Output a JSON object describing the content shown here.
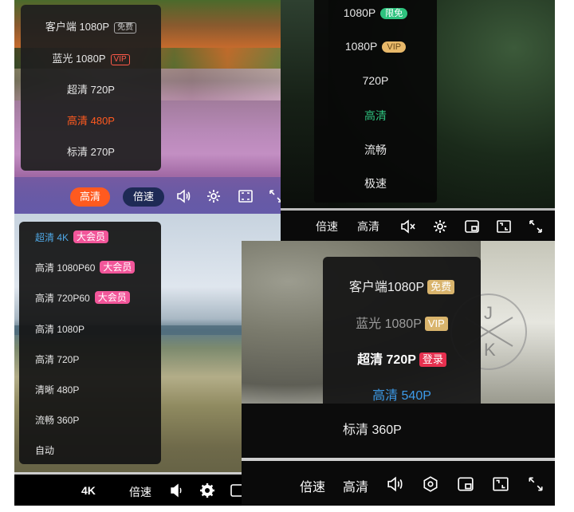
{
  "panel_a": {
    "menu": [
      {
        "label": "客户端 1080P",
        "tag": "免费"
      },
      {
        "label": "蓝光 1080P",
        "tag": "VIP"
      },
      {
        "label": "超清 720P",
        "tag": ""
      },
      {
        "label": "高清 480P",
        "tag": ""
      },
      {
        "label": "标清 270P",
        "tag": ""
      }
    ],
    "selected_index": 3,
    "quality_button": "高清",
    "speed_button": "倍速",
    "colors": {
      "accent": "#ff5a1f",
      "menu_bg": "#1e1e1e"
    }
  },
  "panel_b": {
    "menu": [
      {
        "label": "1080P",
        "tag": "限免"
      },
      {
        "label": "1080P",
        "tag": "VIP"
      },
      {
        "label": "720P",
        "tag": ""
      },
      {
        "label": "高清",
        "tag": ""
      },
      {
        "label": "流畅",
        "tag": ""
      },
      {
        "label": "极速",
        "tag": ""
      }
    ],
    "selected_index": 3,
    "speed_button": "倍速",
    "quality_button": "高清",
    "colors": {
      "accent": "#2ec27e",
      "vip": "#e8b96a"
    }
  },
  "panel_c": {
    "menu": [
      {
        "label": "超清 4K",
        "tag": "大会员"
      },
      {
        "label": "高清 1080P60",
        "tag": "大会员"
      },
      {
        "label": "高清 720P60",
        "tag": "大会员"
      },
      {
        "label": "高清 1080P",
        "tag": ""
      },
      {
        "label": "高清 720P",
        "tag": ""
      },
      {
        "label": "清晰 480P",
        "tag": ""
      },
      {
        "label": "流畅 360P",
        "tag": ""
      },
      {
        "label": "自动",
        "tag": ""
      }
    ],
    "selected_index": 0,
    "quality_button": "4K",
    "speed_button": "倍速",
    "colors": {
      "accent": "#4fa8e6",
      "tag": "#f2569a"
    }
  },
  "panel_d": {
    "menu": [
      {
        "label": "客户端1080P",
        "tag": "免费"
      },
      {
        "label": "蓝光 1080P",
        "tag": "VIP"
      },
      {
        "label": "超清 720P",
        "tag": "登录"
      },
      {
        "label": "高清 540P",
        "tag": ""
      },
      {
        "label": "标清 360P",
        "tag": ""
      }
    ],
    "selected_index": 3,
    "speed_button": "倍速",
    "quality_button": "高清",
    "logo_letters": [
      "J",
      "K"
    ],
    "colors": {
      "accent": "#3d9be9",
      "gold": "#d9b46c",
      "red": "#e6304f"
    }
  }
}
